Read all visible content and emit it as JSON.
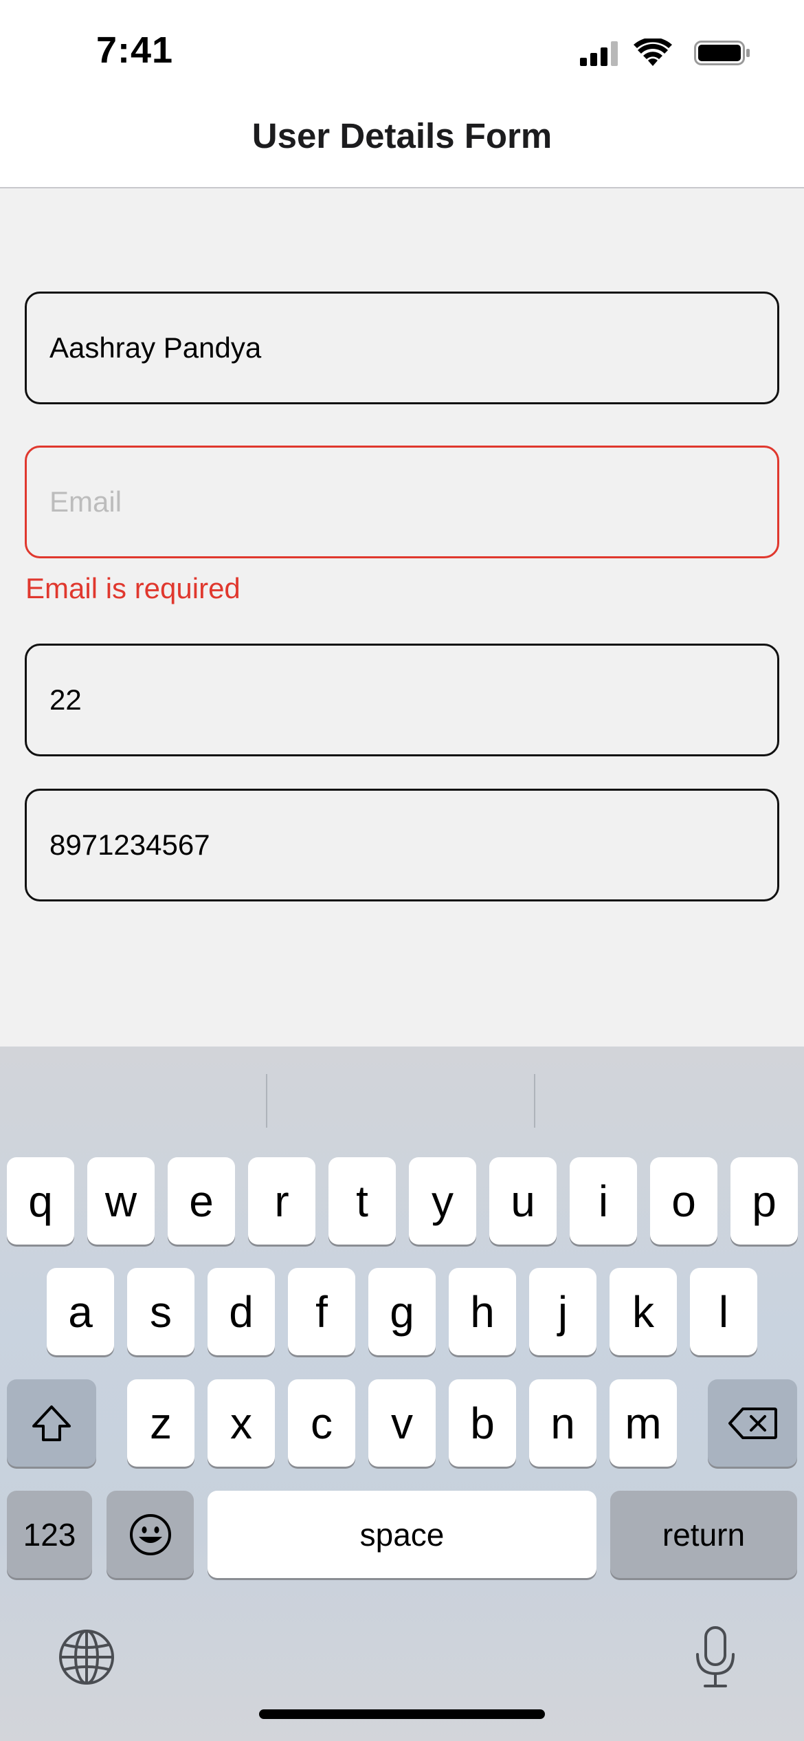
{
  "status_bar": {
    "time": "7:41",
    "icons": [
      "signal-icon",
      "wifi-icon",
      "battery-icon"
    ]
  },
  "header": {
    "title": "User Details Form"
  },
  "form": {
    "name_value": "Aashray Pandya",
    "email_placeholder": "Email",
    "email_value": "",
    "email_error": "Email is required",
    "age_value": "22",
    "phone_value": "8971234567"
  },
  "keyboard": {
    "row1": [
      "q",
      "w",
      "e",
      "r",
      "t",
      "y",
      "u",
      "i",
      "o",
      "p"
    ],
    "row2": [
      "a",
      "s",
      "d",
      "f",
      "g",
      "h",
      "j",
      "k",
      "l"
    ],
    "row3": [
      "z",
      "x",
      "c",
      "v",
      "b",
      "n",
      "m"
    ],
    "numbers_label": "123",
    "space_label": "space",
    "return_label": "return",
    "icons": [
      "shift-icon",
      "backspace-icon",
      "emoji-icon",
      "globe-icon",
      "microphone-icon"
    ]
  },
  "colors": {
    "error": "#e0382e",
    "background": "#f1f1f1",
    "border": "#111111"
  }
}
